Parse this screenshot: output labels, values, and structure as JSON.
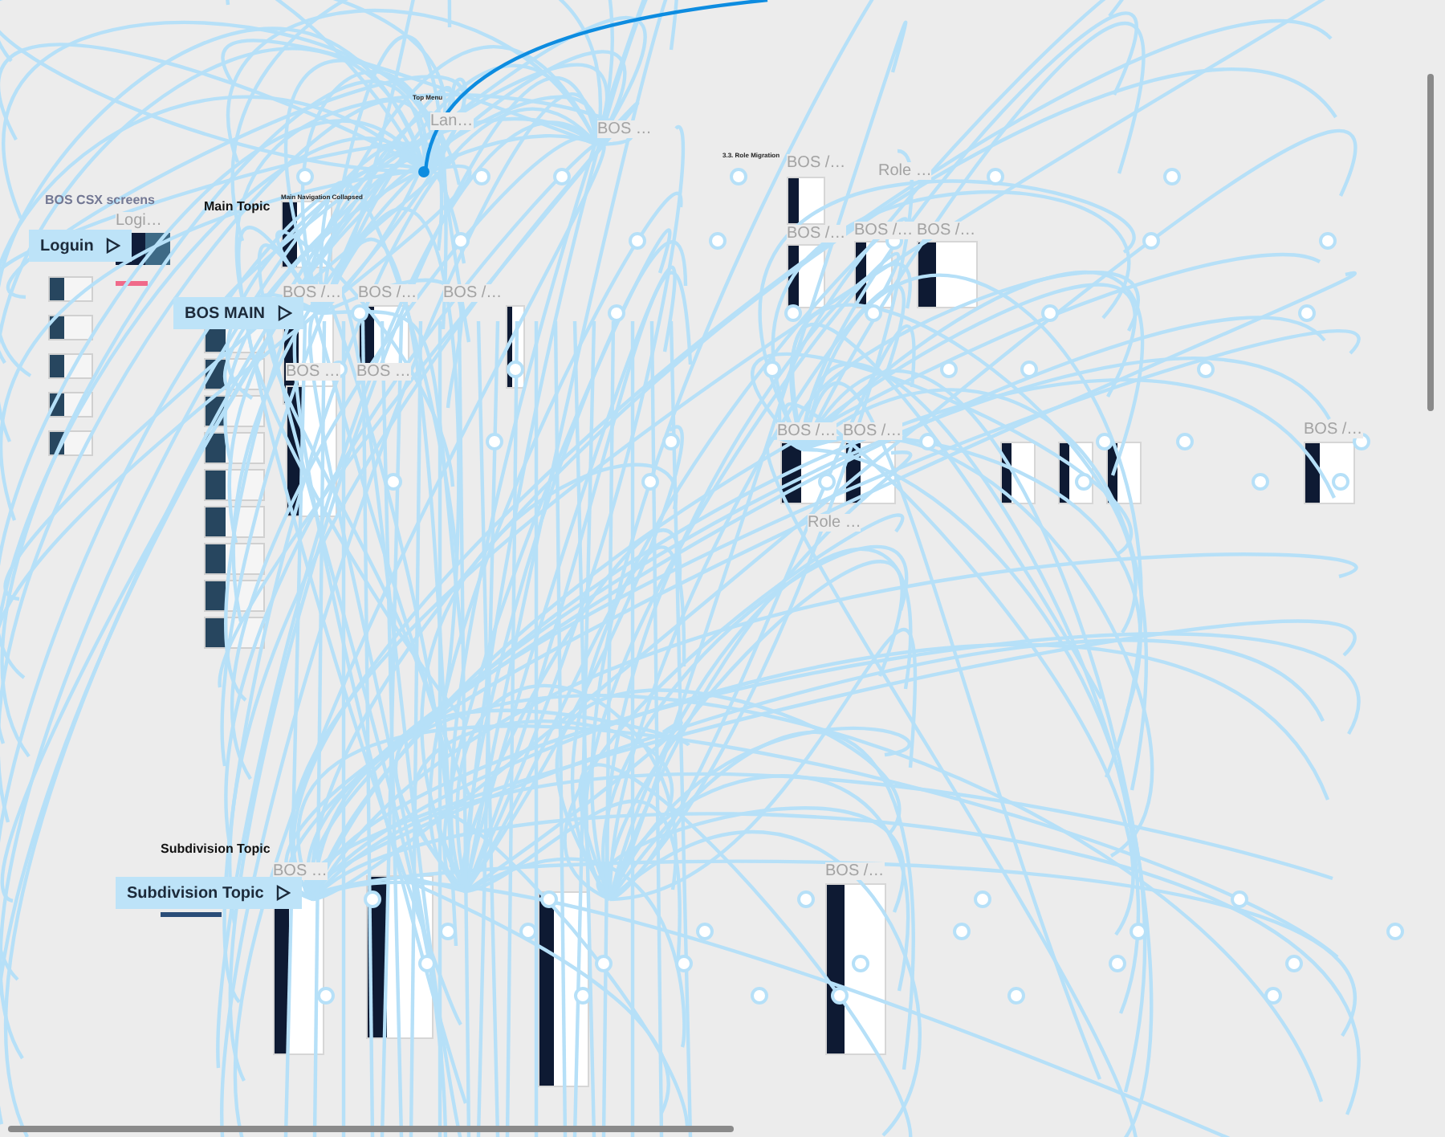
{
  "sections": [
    {
      "title": "BOS CSX screens"
    },
    {
      "title": "Main Topic"
    },
    {
      "title": "Subdivision Topic"
    }
  ],
  "flow_starts": [
    {
      "label": "Loguin"
    },
    {
      "label": "BOS MAIN"
    },
    {
      "label": "Subdivision Topic"
    }
  ],
  "frame_labels": [
    {
      "text": "Logi…"
    },
    {
      "text": "Lan…"
    },
    {
      "text": "BOS …"
    },
    {
      "text": "BOS /…"
    },
    {
      "text": "Role …"
    },
    {
      "text": "BOS /…"
    },
    {
      "text": "BOS /…"
    },
    {
      "text": "BOS /…"
    },
    {
      "text": "BOS /…"
    },
    {
      "text": "BOS /…"
    },
    {
      "text": "BOS /…"
    },
    {
      "text": "BOS …"
    },
    {
      "text": "BOS …"
    },
    {
      "text": "BOS /…"
    },
    {
      "text": "BOS /…"
    },
    {
      "text": "BOS /…"
    },
    {
      "text": "Role …"
    },
    {
      "text": "BOS …"
    },
    {
      "text": "BOS /…"
    }
  ],
  "captions": [
    {
      "text": "Top Menu"
    },
    {
      "text": "Main Navigation Collapsed"
    },
    {
      "text": "3.3. Role Migration"
    }
  ]
}
